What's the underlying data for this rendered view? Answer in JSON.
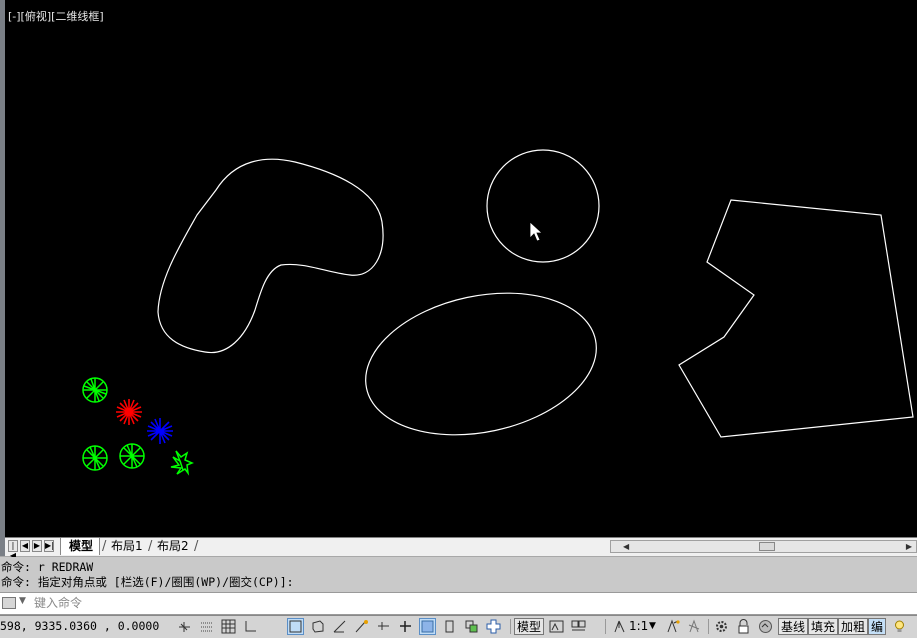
{
  "viewport": {
    "label": "[-][俯视][二维线框]"
  },
  "layout_tabs": {
    "model": "模型",
    "layout1": "布局1",
    "layout2": "布局2"
  },
  "command_history": [
    "命令: r REDRAW",
    "命令: 指定对角点或 [栏选(F)/圈围(WP)/圈交(CP)]:"
  ],
  "command_input": {
    "placeholder": "键入命令"
  },
  "status_bar": {
    "coords": "598, 9335.0360 , 0.0000",
    "model_label": "模型",
    "scale_label": "1:1",
    "baseline_label": "基线",
    "fill_label": "填充",
    "bold_label": "加粗",
    "edit_label": "编"
  },
  "icons": {
    "cursor": "arrow-cursor-icon",
    "grid": "grid-icon",
    "snap": "snap-icon",
    "ortho": "ortho-icon",
    "polar": "polar-icon",
    "osnap": "object-snap-icon",
    "settings": "gear-icon",
    "lock": "lock-icon",
    "bulb": "lightbulb-icon"
  },
  "colors": {
    "viewport_bg": "#000000",
    "geometry": "#ffffff",
    "green": "#00ff00",
    "red": "#ff0000",
    "blue": "#0000ff"
  }
}
